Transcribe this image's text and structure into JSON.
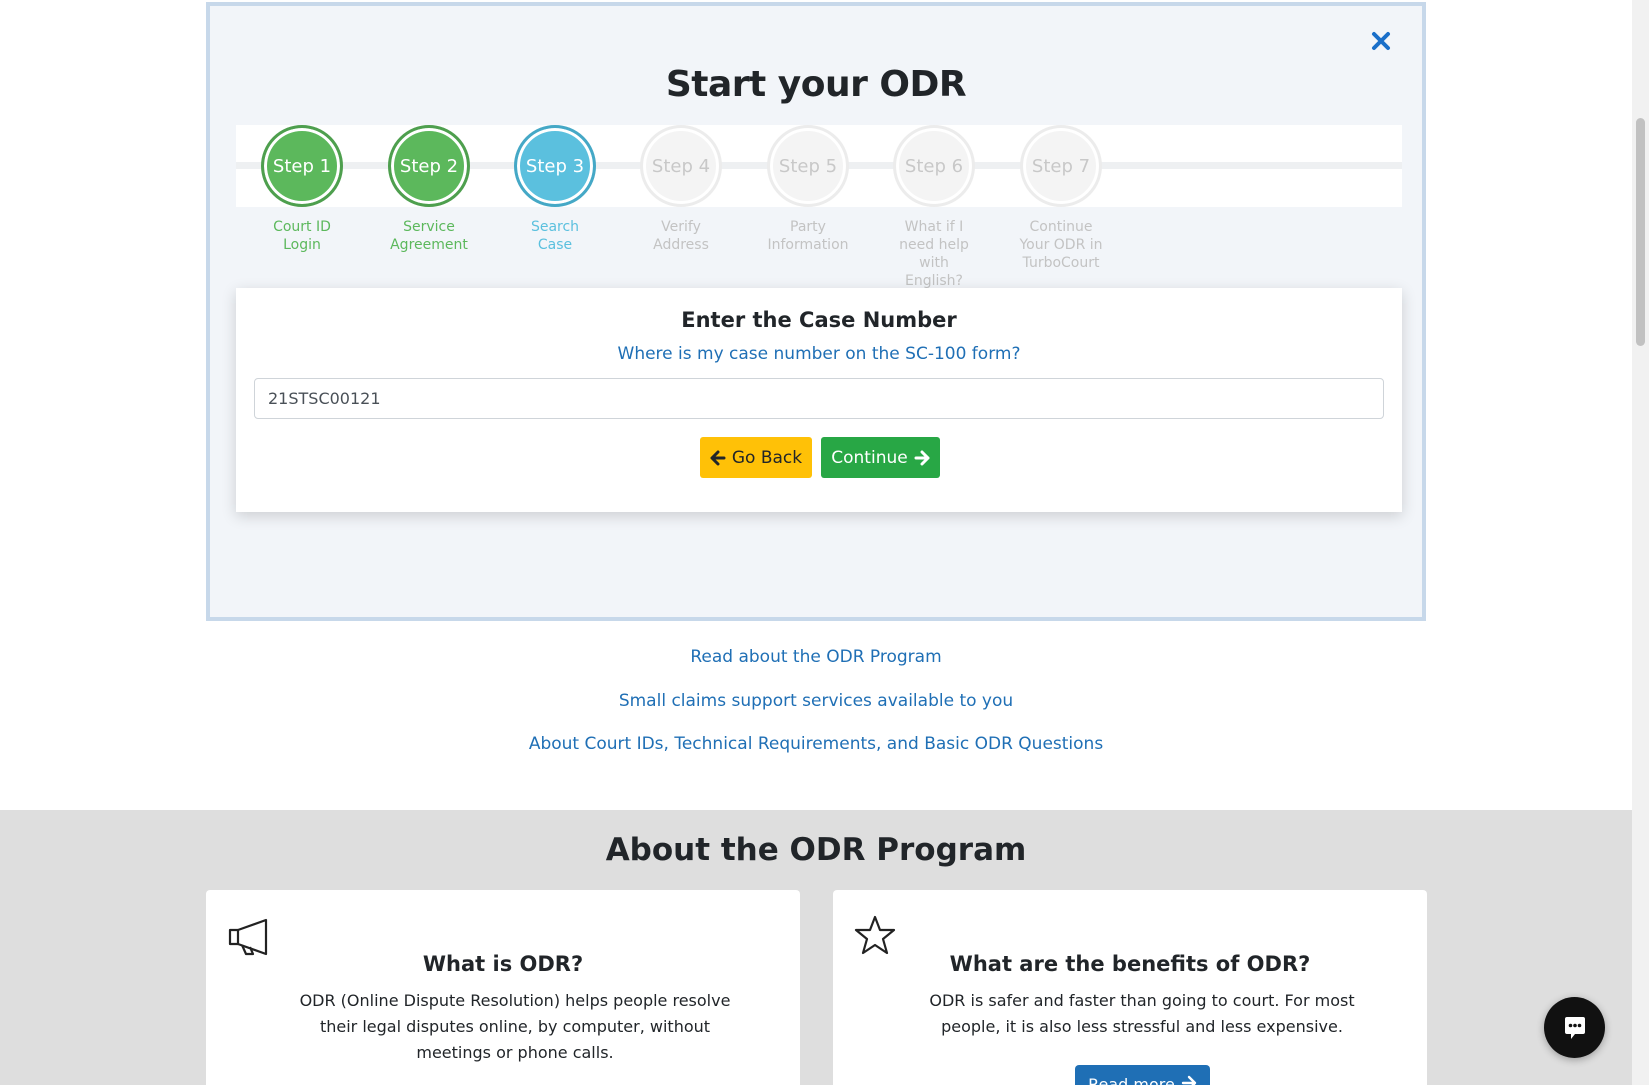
{
  "panel": {
    "title": "Start your ODR"
  },
  "steps": [
    {
      "circle": "Step 1",
      "label": "Court ID Login",
      "state": "done"
    },
    {
      "circle": "Step 2",
      "label": "Service Agreement",
      "state": "done"
    },
    {
      "circle": "Step 3",
      "label": "Search Case",
      "state": "active"
    },
    {
      "circle": "Step 4",
      "label": "Verify Address",
      "state": "todo"
    },
    {
      "circle": "Step 5",
      "label": "Party Information",
      "state": "todo"
    },
    {
      "circle": "Step 6",
      "label": "What if I need help with English?",
      "state": "todo"
    },
    {
      "circle": "Step 7",
      "label": "Continue Your ODR in TurboCourt",
      "state": "todo"
    }
  ],
  "case_form": {
    "title": "Enter the Case Number",
    "help_link": "Where is my case number on the SC-100 form?",
    "case_number_value": "21STSC00121",
    "back_label": "Go Back",
    "continue_label": "Continue"
  },
  "links": {
    "read_about": "Read about the ODR Program",
    "support": "Small claims support services available to you",
    "faq": "About Court IDs, Technical Requirements, and Basic ODR Questions"
  },
  "about": {
    "title": "About the ODR Program",
    "cards": [
      {
        "icon": "megaphone-icon",
        "title": "What is ODR?",
        "text": "ODR (Online Dispute Resolution) helps people resolve their legal disputes online, by computer, without meetings or phone calls."
      },
      {
        "icon": "star-icon",
        "title": "What are the benefits of ODR?",
        "text": "ODR is safer and faster than going to court. For most people, it is also less stressful and less expensive.",
        "button": "Read more"
      }
    ]
  },
  "colors": {
    "step_done": "#5cb85c",
    "step_active": "#5bc0de",
    "step_todo": "#f4f4f4",
    "link": "#1f6fb5",
    "go_back": "#ffc107",
    "continue": "#28a745",
    "close": "#1a6fc9"
  }
}
